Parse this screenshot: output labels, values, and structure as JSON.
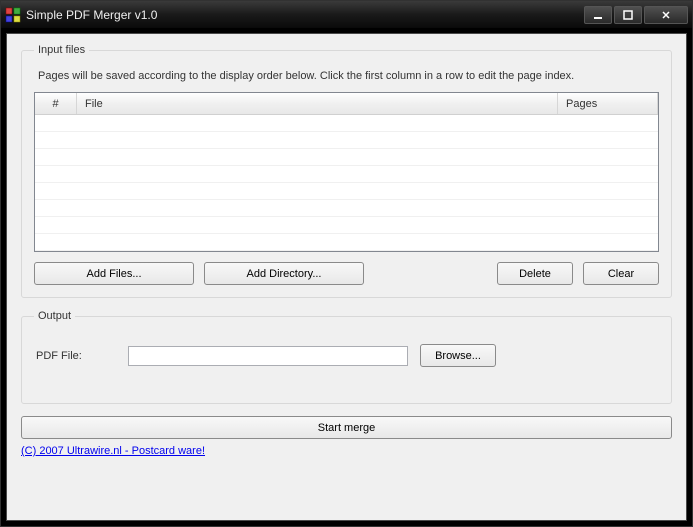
{
  "window": {
    "title": "Simple PDF Merger v1.0"
  },
  "input_group": {
    "legend": "Input files",
    "hint": "Pages will be saved according to the display order below. Click the first column in a row to edit the page index.",
    "columns": {
      "num": "#",
      "file": "File",
      "pages": "Pages"
    },
    "buttons": {
      "add_files": "Add Files...",
      "add_dir": "Add Directory...",
      "delete": "Delete",
      "clear": "Clear"
    }
  },
  "output_group": {
    "legend": "Output",
    "label": "PDF File:",
    "value": "",
    "browse": "Browse..."
  },
  "start": "Start merge",
  "footer": "(C) 2007 Ultrawire.nl - Postcard ware!"
}
